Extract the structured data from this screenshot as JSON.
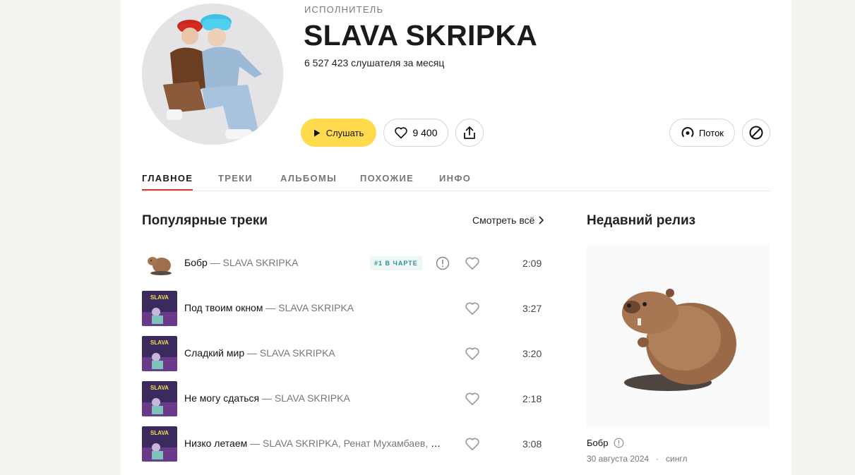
{
  "artist": {
    "kind_label": "ИСПОЛНИТЕЛЬ",
    "name": "SLAVA SKRIPKA",
    "listeners": "6 527 423 слушателя за месяц"
  },
  "actions": {
    "play_label": "Слушать",
    "likes": "9 400",
    "flow_label": "Поток"
  },
  "tabs": [
    {
      "label": "ГЛАВНОЕ",
      "active": true
    },
    {
      "label": "ТРЕКИ"
    },
    {
      "label": "АЛЬБОМЫ"
    },
    {
      "label": "ПОХОЖИЕ"
    },
    {
      "label": "ИНФО"
    }
  ],
  "popular": {
    "title": "Популярные треки",
    "see_all": "Смотреть всё",
    "tracks": [
      {
        "title": "Бобр",
        "artist": " — SLAVA SKRIPKA",
        "duration": "2:09",
        "badge": "#1 В ЧАРТЕ",
        "cover": "beaver"
      },
      {
        "title": "Под твоим окном",
        "artist": " — SLAVA SKRIPKA",
        "duration": "3:27",
        "cover": "album"
      },
      {
        "title": "Сладкий мир",
        "artist": " — SLAVA SKRIPKA",
        "duration": "3:20",
        "cover": "album"
      },
      {
        "title": "Не могу сдаться",
        "artist": " — SLAVA SKRIPKA",
        "duration": "2:18",
        "cover": "album"
      },
      {
        "title": "Низко летаем",
        "artist": " — SLAVA SKRIPKA, Ренат Мухамбаев, Ми...",
        "duration": "3:08",
        "cover": "album"
      }
    ]
  },
  "recent_release": {
    "title": "Недавний релиз",
    "name": "Бобр",
    "date": "30 августа 2024",
    "separator": "·",
    "type": "сингл"
  },
  "colors": {
    "accent_yellow": "#ffdb4d",
    "active_tab_underline": "#e3342f",
    "chart_badge_text": "#2f8fa0"
  }
}
